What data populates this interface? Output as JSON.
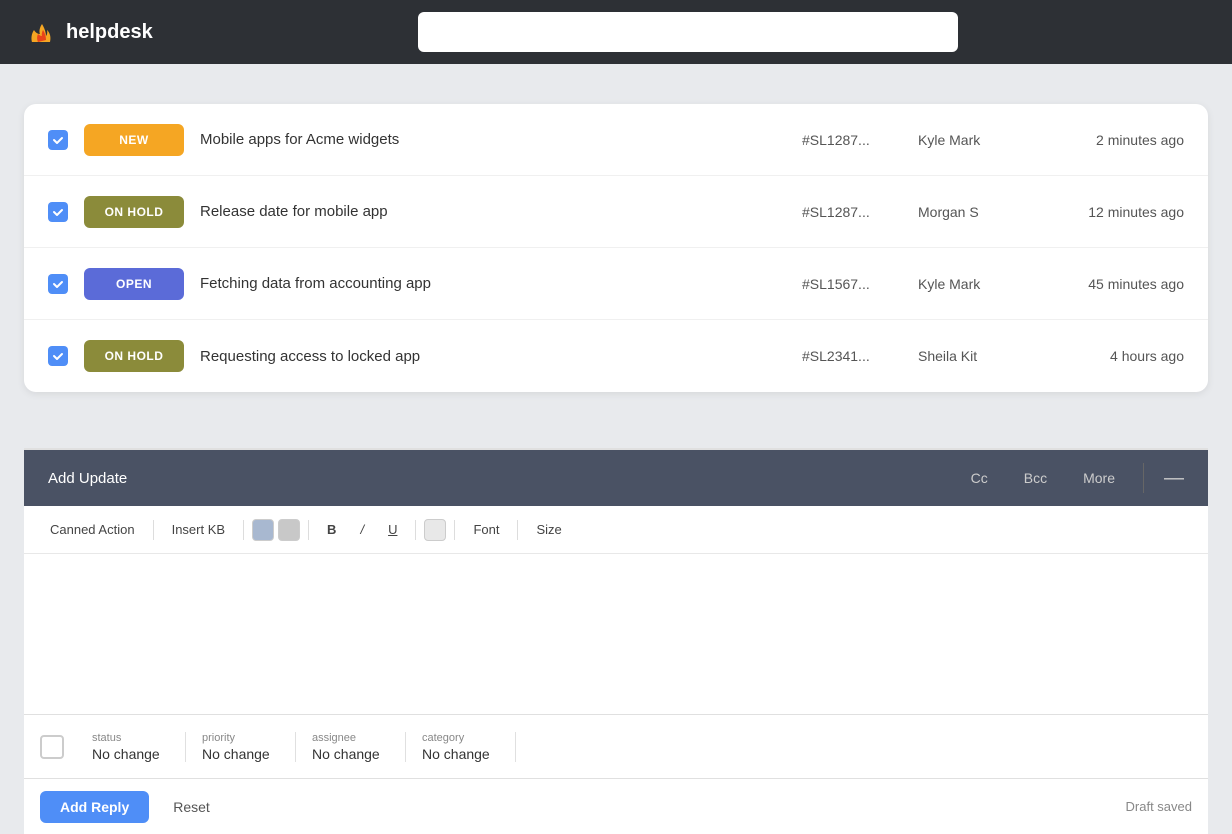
{
  "header": {
    "logo_text": "helpdesk",
    "search_placeholder": ""
  },
  "tickets": [
    {
      "id": 1,
      "status": "NEW",
      "status_class": "badge-new",
      "title": "Mobile apps for Acme widgets",
      "ticket_id": "#SL1287...",
      "assignee": "Kyle Mark",
      "time": "2 minutes ago"
    },
    {
      "id": 2,
      "status": "ON HOLD",
      "status_class": "badge-onhold",
      "title": "Release date for mobile app",
      "ticket_id": "#SL1287...",
      "assignee": "Morgan S",
      "time": "12 minutes ago"
    },
    {
      "id": 3,
      "status": "OPEN",
      "status_class": "badge-open",
      "title": "Fetching data from accounting app",
      "ticket_id": "#SL1567...",
      "assignee": "Kyle Mark",
      "time": "45 minutes ago"
    },
    {
      "id": 4,
      "status": "ON HOLD",
      "status_class": "badge-onhold",
      "title": "Requesting access to locked app",
      "ticket_id": "#SL2341...",
      "assignee": "Sheila Kit",
      "time": "4 hours ago"
    }
  ],
  "editor": {
    "add_update_label": "Add Update",
    "cc_label": "Cc",
    "bcc_label": "Bcc",
    "more_label": "More",
    "canned_action_label": "Canned Action",
    "insert_kb_label": "Insert KB",
    "bold_label": "B",
    "italic_label": "/",
    "underline_label": "U",
    "font_label": "Font",
    "size_label": "Size"
  },
  "footer": {
    "status_label": "status",
    "status_value": "No change",
    "priority_label": "priority",
    "priority_value": "No change",
    "assignee_label": "assignee",
    "assignee_value": "No change",
    "category_label": "category",
    "category_value": "No change"
  },
  "actions": {
    "add_reply_label": "Add Reply",
    "reset_label": "Reset",
    "draft_saved_label": "Draft saved"
  }
}
